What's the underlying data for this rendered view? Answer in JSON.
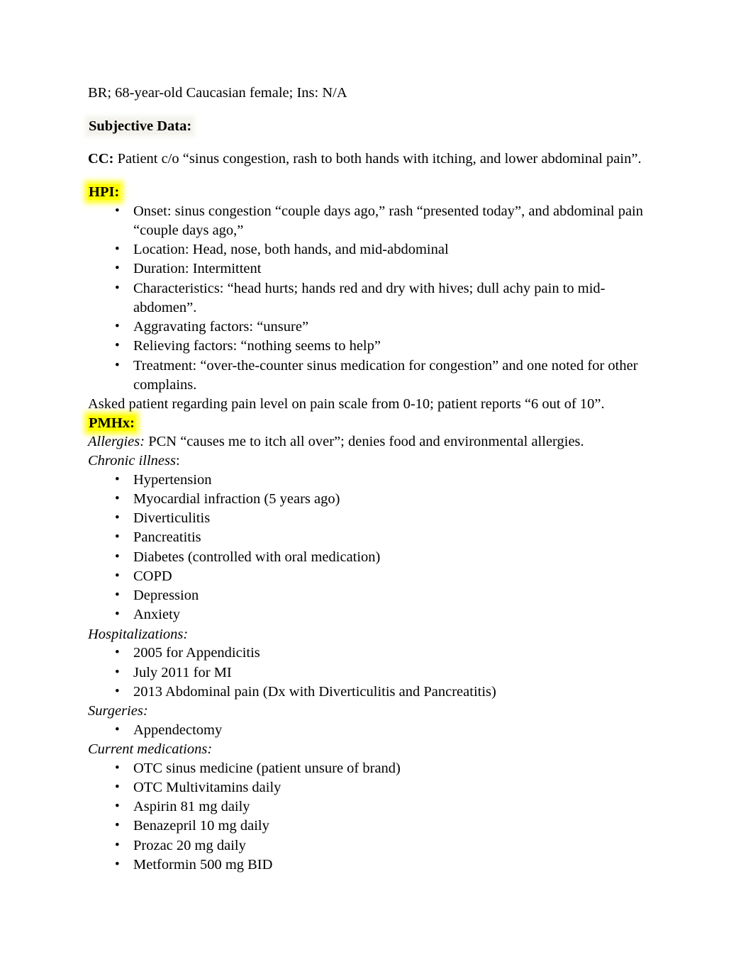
{
  "document": {
    "header_line": "BR; 68-year-old Caucasian female; Ins: N/A",
    "sections": {
      "subjective": {
        "heading": "Subjective Data:",
        "heading_highlight": "#f3f1e9"
      },
      "cc": {
        "label": "CC:",
        "text": " Patient c/o “sinus congestion, rash to both hands with itching, and lower abdominal pain”."
      },
      "hpi": {
        "heading": "HPI:",
        "heading_highlight": "#ffff00",
        "bullets": [
          "Onset: sinus congestion “couple days ago,” rash “presented today”, and abdominal pain “couple days ago,”",
          "Location: Head, nose, both hands, and mid-abdominal",
          "Duration: Intermittent",
          "Characteristics: “head hurts; hands red and dry with hives; dull achy pain to mid-abdomen”.",
          "Aggravating factors: “unsure”",
          "Relieving factors: “nothing seems to help”",
          "Treatment: “over-the-counter sinus medication for congestion” and one noted for other complains."
        ],
        "closing_line": "Asked patient regarding pain level on pain scale from 0-10; patient reports “6 out of 10”."
      },
      "pmhx": {
        "heading": "PMHx:",
        "heading_highlight": "#ffff00",
        "allergies": {
          "label": "Allergies:",
          "text": " PCN “causes me to itch all over”; denies food and environmental allergies."
        },
        "chronic_illness": {
          "label": "Chronic illness",
          "label_suffix": ":",
          "items": [
            "Hypertension",
            "Myocardial infraction (5 years ago)",
            "Diverticulitis",
            "Pancreatitis",
            "Diabetes (controlled with oral medication)",
            "COPD",
            "Depression",
            "Anxiety"
          ]
        },
        "hospitalizations": {
          "label": "Hospitalizations:",
          "items": [
            "2005 for Appendicitis",
            "July 2011 for MI",
            "2013 Abdominal pain (Dx with Diverticulitis and Pancreatitis)"
          ]
        },
        "surgeries": {
          "label": "Surgeries:",
          "items": [
            "Appendectomy"
          ]
        },
        "current_medications": {
          "label": "Current medications:",
          "items": [
            "OTC sinus medicine (patient unsure of brand)",
            "OTC Multivitamins daily",
            "Aspirin 81 mg daily",
            "Benazepril 10 mg daily",
            "Prozac 20 mg daily",
            "Metformin 500 mg BID"
          ]
        }
      }
    }
  }
}
